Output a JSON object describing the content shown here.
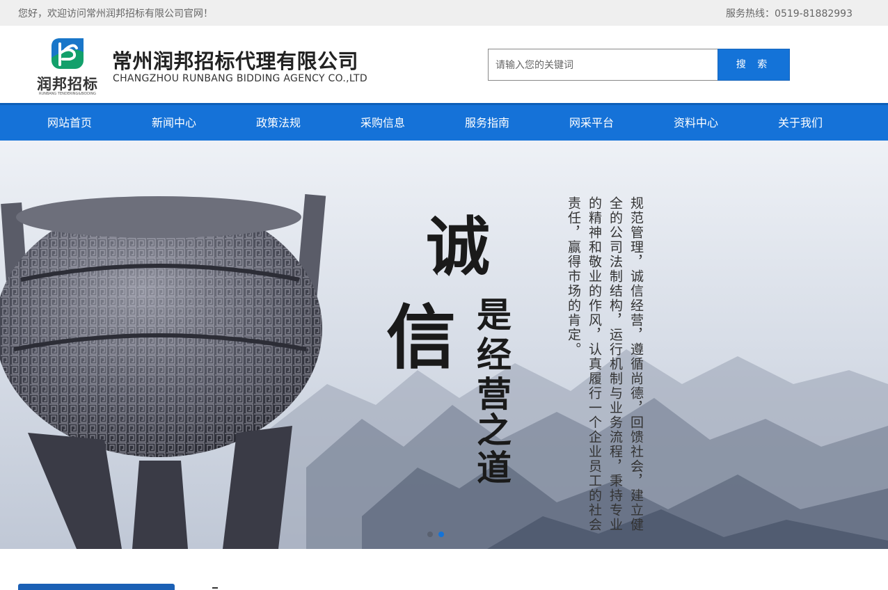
{
  "topbar": {
    "welcome": "您好，欢迎访问常州润邦招标有限公司官网！",
    "hotline": "服务热线：0519-81882993"
  },
  "header": {
    "logo_cn": "润邦招标",
    "logo_en": "RUNBANG TENDERING&BIDDING",
    "company_cn": "常州润邦招标代理有限公司",
    "company_en": "CHANGZHOU RUNBANG BIDDING AGENCY CO.,LTD"
  },
  "search": {
    "placeholder": "请输入您的关键词",
    "button": "搜 索"
  },
  "nav": {
    "items": [
      {
        "label": "网站首页"
      },
      {
        "label": "新闻中心"
      },
      {
        "label": "政策法规"
      },
      {
        "label": "采购信息"
      },
      {
        "label": "服务指南"
      },
      {
        "label": "网采平台"
      },
      {
        "label": "资料中心"
      },
      {
        "label": "关于我们"
      }
    ]
  },
  "banner": {
    "calligraphy_big": "诚信",
    "calligraphy_small": "是经营之道",
    "columns": [
      "规范管理，诚信经营，遵循尚德，回馈社会，建立健",
      "全的公司法制结构，运行机制与业务流程，秉持专业",
      "的精神和敬业的作风，认真履行一个企业员工的社会",
      "责任，赢得市场的肯定。"
    ],
    "slides": 2,
    "active_slide": 2
  },
  "colors": {
    "nav_blue": "#1572d8",
    "accent_blue": "#1473d8",
    "topbar_gray": "#efefef"
  }
}
